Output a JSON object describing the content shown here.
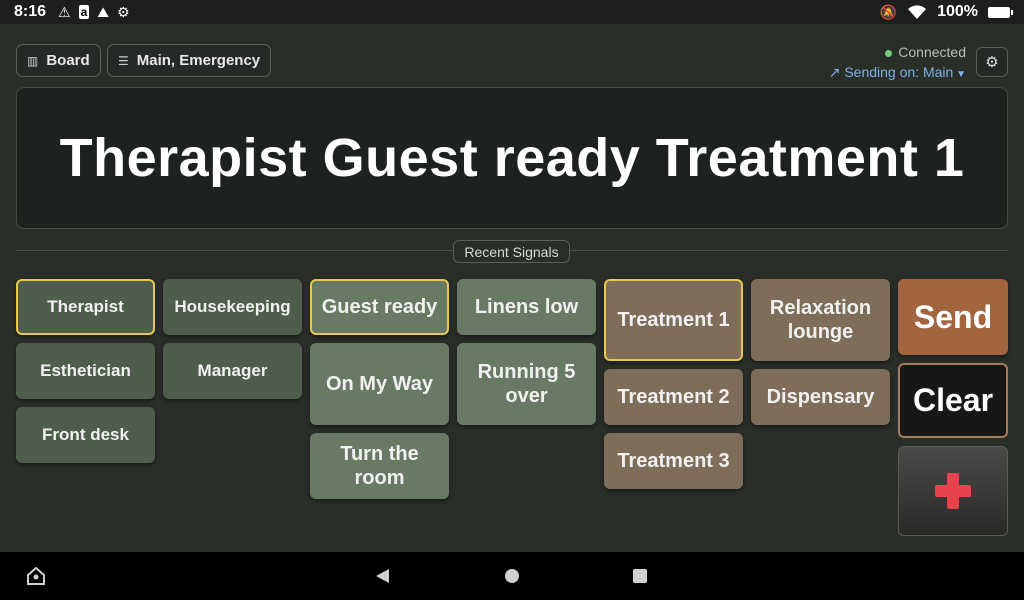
{
  "status_bar": {
    "time": "8:16",
    "battery": "100%",
    "icons": [
      "warning-icon",
      "amazon-icon",
      "mountain-icon",
      "settings-icon",
      "mute-icon",
      "wifi-icon",
      "battery-icon"
    ]
  },
  "toolbar": {
    "board_label": "Board",
    "channels_label": "Main, Emergency",
    "connection_status": "Connected",
    "sending_label": "Sending on: Main"
  },
  "display": {
    "message": "Therapist Guest ready Treatment 1"
  },
  "recent_label": "Recent Signals",
  "people": [
    "Therapist",
    "Housekeeping",
    "Esthetician",
    "Manager",
    "Front desk"
  ],
  "messages": [
    "Guest ready",
    "Linens low",
    "On My Way",
    "Running 5 over",
    "Turn the room"
  ],
  "rooms": [
    "Treatment 1",
    "Relaxation lounge",
    "Treatment 2",
    "Dispensary",
    "Treatment 3"
  ],
  "actions": {
    "send": "Send",
    "clear": "Clear"
  },
  "colors": {
    "accent_selected": "#e9c94c",
    "send": "#a2653f",
    "emergency_cross": "#e8424c",
    "connected": "#6fcf7a",
    "sending": "#7fb2e6"
  }
}
